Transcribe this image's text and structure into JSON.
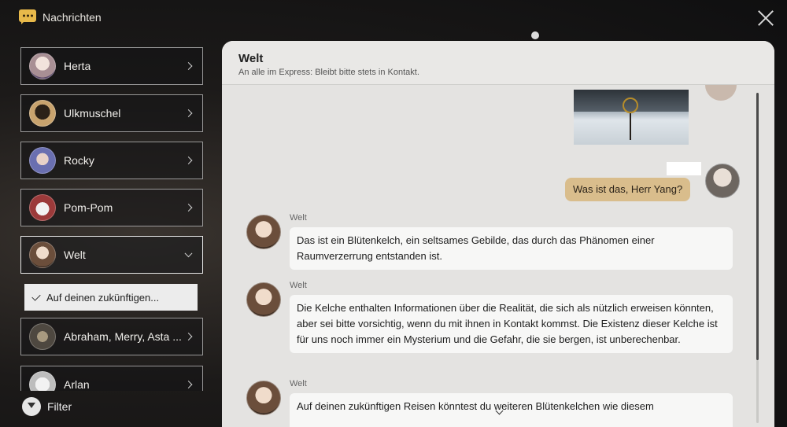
{
  "header": {
    "title": "Nachrichten",
    "icon": "chat-bubble-icon",
    "close_icon": "close-icon"
  },
  "sidebar": {
    "contacts": [
      {
        "name": "Herta",
        "color": "#b9a3a0"
      },
      {
        "name": "Ulkmuschel",
        "color": "#c19a6b"
      },
      {
        "name": "Rocky",
        "color": "#6b6fa8"
      },
      {
        "name": "Pom-Pom",
        "color": "#8c3b3b"
      },
      {
        "name": "Welt",
        "color": "#7a5a44"
      }
    ],
    "active_sub": "Auf deinen zukünftigen...",
    "more_contacts": [
      {
        "name": "Abraham, Merry, Asta ...",
        "color": "#6c6458"
      },
      {
        "name": "Arlan",
        "color": "#c9c9c9"
      }
    ],
    "filter_label": "Filter"
  },
  "chat": {
    "title": "Welt",
    "subtitle": "An alle im Express: Bleibt bitte stets in Kontakt.",
    "self_message": "Was ist das, Herr Yang?",
    "messages": [
      {
        "sender": "Welt",
        "text": "Das ist ein Blütenkelch, ein seltsames Gebilde, das durch das Phänomen einer Raumverzerrung entstanden ist."
      },
      {
        "sender": "Welt",
        "text": "Die Kelche enthalten Informationen über die Realität, die sich als nützlich erweisen könnten, aber sei bitte vorsichtig, wenn du mit ihnen in Kontakt kommst. Die Existenz dieser Kelche ist für uns noch immer ein Mysterium und die Gefahr, die sie bergen, ist unberechenbar."
      },
      {
        "sender": "Welt",
        "text": "Auf deinen zukünftigen Reisen könntest du weiteren Blütenkelchen wie diesem"
      }
    ]
  },
  "colors": {
    "accent": "#e8b94a",
    "self_bubble": "#d9bd8c",
    "panel": "#e4e3e1"
  }
}
